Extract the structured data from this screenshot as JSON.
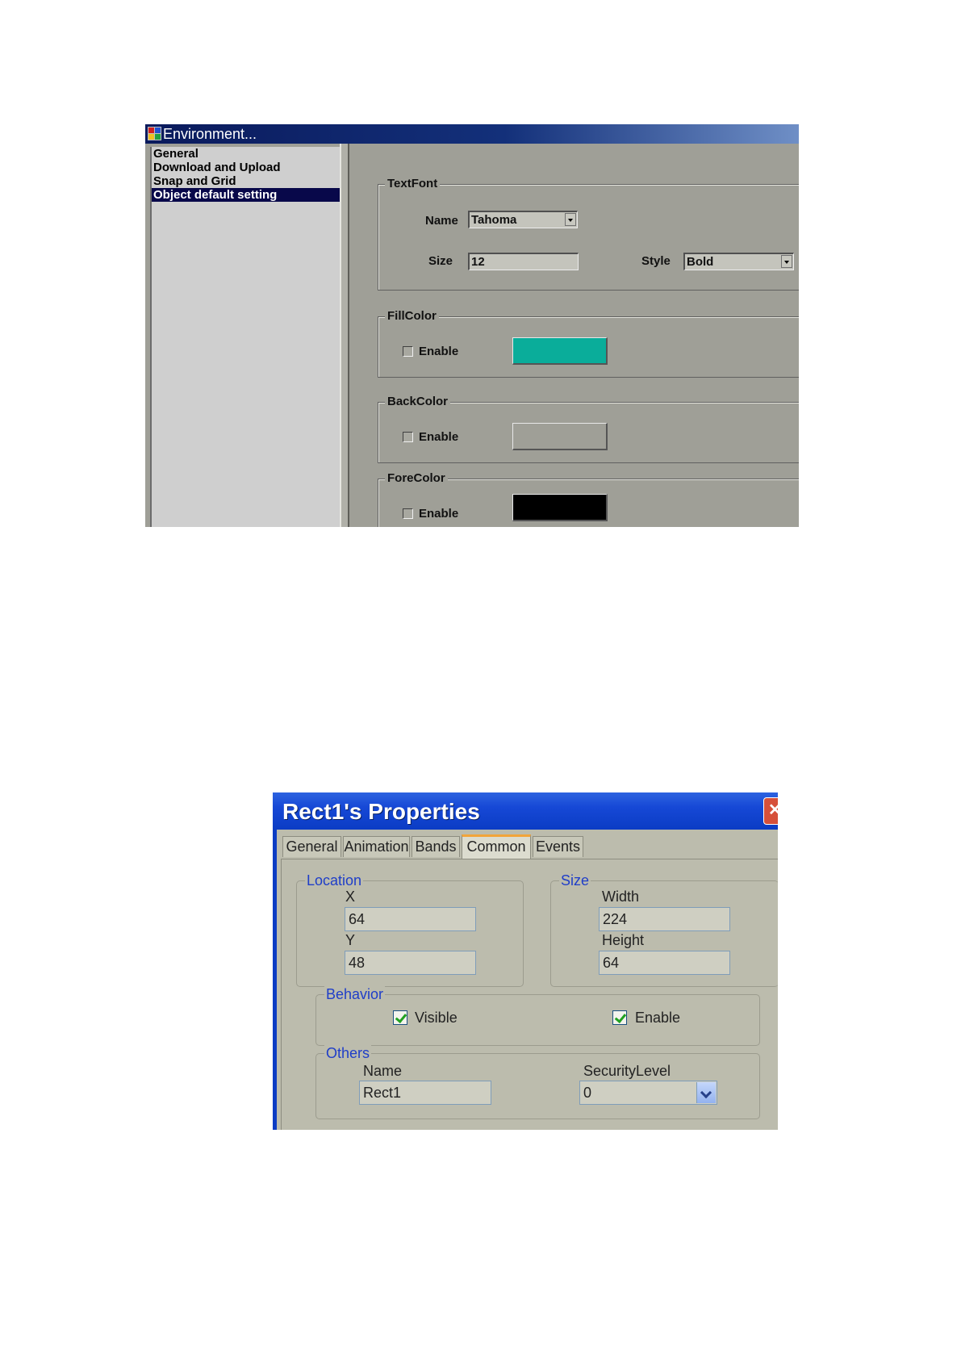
{
  "environment_dialog": {
    "title": "Environment...",
    "nav_items": [
      {
        "label": "General",
        "selected": false
      },
      {
        "label": "Download and Upload",
        "selected": false
      },
      {
        "label": "Snap and Grid",
        "selected": false
      },
      {
        "label": "Object default setting",
        "selected": true
      }
    ],
    "text_font": {
      "legend": "TextFont",
      "name_label": "Name",
      "name_value": "Tahoma",
      "size_label": "Size",
      "size_value": "12",
      "style_label": "Style",
      "style_value": "Bold"
    },
    "fill_color": {
      "legend": "FillColor",
      "enable_label": "Enable",
      "enabled": false,
      "color": "#0aad9a"
    },
    "back_color": {
      "legend": "BackColor",
      "enable_label": "Enable",
      "enabled": false,
      "color": "#9f9f97"
    },
    "fore_color": {
      "legend": "ForeColor",
      "enable_label": "Enable",
      "enabled": false,
      "color": "#000000"
    }
  },
  "properties_dialog": {
    "title": "Rect1's Properties",
    "tabs": [
      {
        "label": "General",
        "active": false
      },
      {
        "label": "Animation",
        "active": false
      },
      {
        "label": "Bands",
        "active": false
      },
      {
        "label": "Common",
        "active": true
      },
      {
        "label": "Events",
        "active": false
      }
    ],
    "location": {
      "legend": "Location",
      "x_label": "X",
      "x_value": "64",
      "y_label": "Y",
      "y_value": "48"
    },
    "size": {
      "legend": "Size",
      "width_label": "Width",
      "width_value": "224",
      "height_label": "Height",
      "height_value": "64"
    },
    "behavior": {
      "legend": "Behavior",
      "visible_label": "Visible",
      "visible_checked": true,
      "enable_label": "Enable",
      "enable_checked": true
    },
    "others": {
      "legend": "Others",
      "name_label": "Name",
      "name_value": "Rect1",
      "security_label": "SecurityLevel",
      "security_value": "0"
    }
  },
  "colors": {
    "env_title_dark": "#0a1a5c",
    "env_selection": "#08084a",
    "props_title_blue": "#1648d6",
    "props_legend_blue": "#1f3ec8"
  }
}
